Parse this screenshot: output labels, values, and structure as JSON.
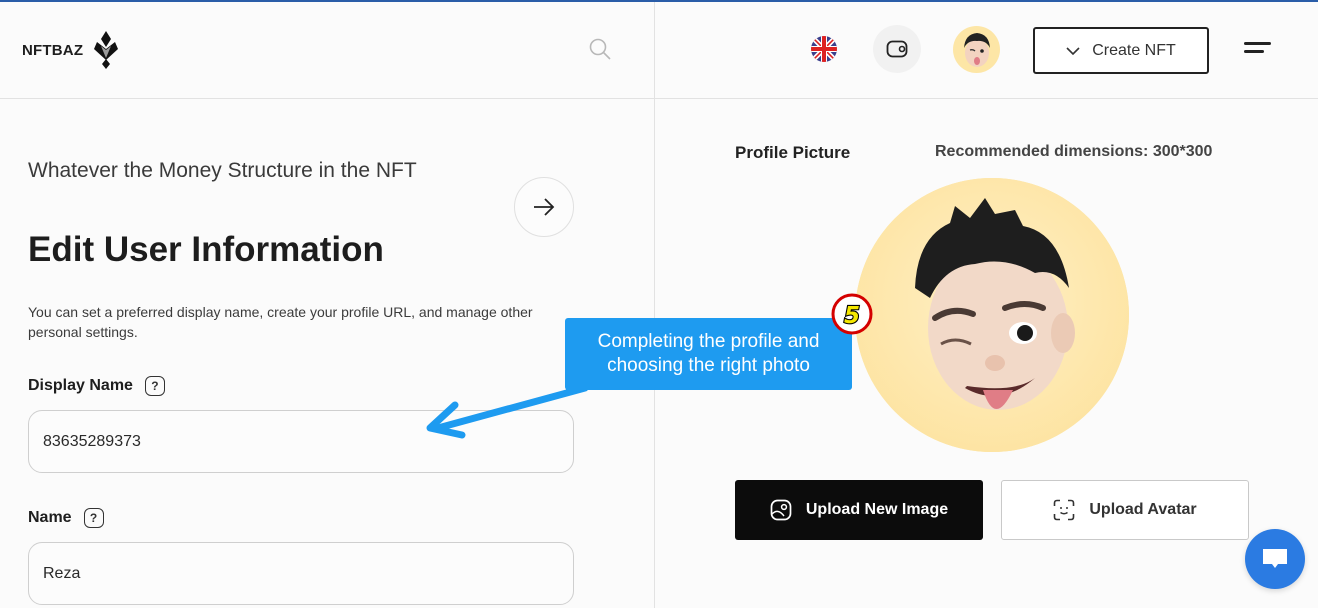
{
  "header": {
    "brand": "NFTBAZ",
    "search_icon": "search-icon",
    "language_icon": "uk-flag-icon",
    "wallet_icon": "wallet-icon",
    "avatar_icon": "avatar-icon",
    "create_button": "Create NFT",
    "menu_icon": "hamburger-menu-icon"
  },
  "main": {
    "subtitle": "Whatever the Money Structure in the NFT",
    "title": "Edit User Information",
    "description": "You can set a preferred display name, create your profile URL, and manage other personal settings.",
    "fields": [
      {
        "label": "Display Name",
        "value": "83635289373",
        "help": "?"
      },
      {
        "label": "Name",
        "value": "Reza",
        "help": "?"
      }
    ]
  },
  "profile": {
    "label": "Profile Picture",
    "dimensions": "Recommended dimensions: 300*300",
    "upload_image_label": "Upload New Image",
    "upload_avatar_label": "Upload Avatar"
  },
  "annotation": {
    "callout_text": "Completing the profile and choosing the right photo",
    "step_number": "5",
    "callout_color": "#1e9bf0"
  },
  "chat": {
    "icon": "chat-bubble-icon"
  }
}
